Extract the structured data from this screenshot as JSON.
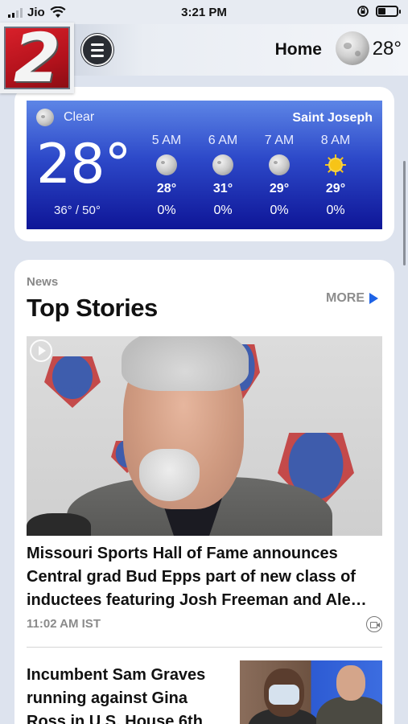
{
  "status_bar": {
    "carrier": "Jio",
    "time": "3:21 PM"
  },
  "header": {
    "logo_text": "2",
    "nav_label": "Home",
    "temperature": "28°",
    "weather_icon": "moon-icon"
  },
  "weather": {
    "condition": "Clear",
    "location": "Saint Joseph",
    "current_temp": "28°",
    "hi_lo": "36° / 50°",
    "hourly": [
      {
        "time": "5 AM",
        "icon": "moon-icon",
        "temp": "28°",
        "precip": "0%"
      },
      {
        "time": "6 AM",
        "icon": "moon-icon",
        "temp": "31°",
        "precip": "0%"
      },
      {
        "time": "7 AM",
        "icon": "moon-icon",
        "temp": "29°",
        "precip": "0%"
      },
      {
        "time": "8 AM",
        "icon": "sun-icon",
        "temp": "29°",
        "precip": "0%"
      }
    ]
  },
  "news": {
    "section_label": "News",
    "title": "Top Stories",
    "more_label": "MORE",
    "stories": [
      {
        "headline": "Missouri Sports Hall of Fame announces Central grad Bud Epps part of new class of inductees featuring Josh Freeman and Ale…",
        "time": "11:02 AM IST",
        "media_icon": "video-icon"
      },
      {
        "headline": "Incumbent Sam Graves running against Gina Ross in U.S. House 6th…"
      }
    ]
  },
  "colors": {
    "weather_gradient_top": "#5d85e6",
    "weather_gradient_bottom": "#0e1597",
    "more_arrow": "#1e63e6",
    "logo_red": "#d8202a"
  }
}
